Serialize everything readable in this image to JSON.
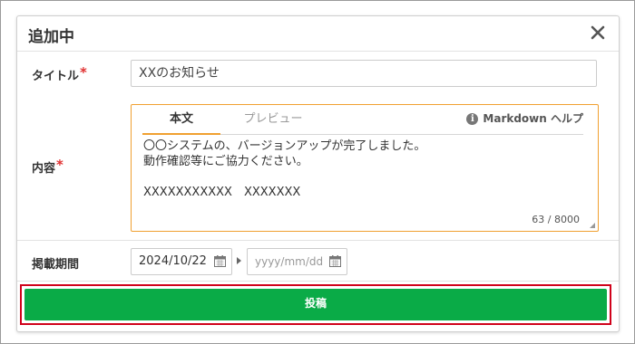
{
  "dialog": {
    "title": "追加中",
    "close_icon": "close-icon"
  },
  "form": {
    "title_label": "タイトル",
    "title_required_mark": "*",
    "title_value": "XXのお知らせ",
    "content_label": "内容",
    "content_required_mark": "*",
    "tabs": {
      "body": "本文",
      "preview": "プレビュー"
    },
    "markdown_help": "Markdown ヘルプ",
    "content_text": "〇〇システムの、バージョンアップが完了しました。\n動作確認等にご協力ください。\n\nXXXXXXXXXXX　XXXXXXX",
    "char_counter": "63 / 8000",
    "period_label": "掲載期間",
    "date_from_value": "2024/10/22",
    "date_to_placeholder": "yyyy/mm/dd",
    "submit_label": "投稿"
  },
  "colors": {
    "accent_orange": "#f0a030",
    "submit_green": "#0aab47",
    "highlight_red": "#d0021b",
    "required_red": "#e03131"
  }
}
